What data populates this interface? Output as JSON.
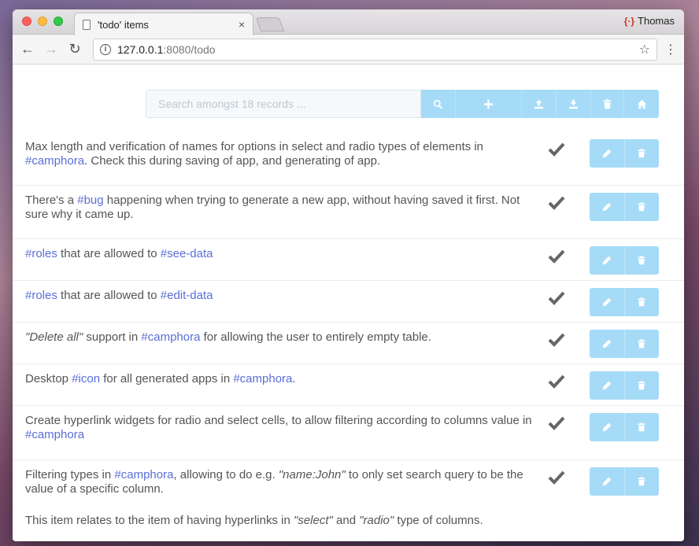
{
  "browser": {
    "tab_title": "'todo' items",
    "tab_close": "×",
    "profile_name": "Thomas",
    "url_host": "127.0.0.1",
    "url_rest": ":8080/todo",
    "back": "←",
    "forward": "→",
    "reload": "↻",
    "star": "☆",
    "menu": "⋮"
  },
  "search": {
    "placeholder": "Search amongst 18 records ...",
    "buttons": [
      "search-icon",
      "plus-icon",
      "upload-icon",
      "download-icon",
      "trash-icon",
      "home-icon"
    ]
  },
  "accent": "#a6dbf7",
  "tag_color": "#5a6fd6",
  "items": [
    {
      "parts": [
        {
          "t": "Max length and verification of names for options in select and radio types of elements in "
        },
        {
          "t": "#camphora",
          "tag": true
        },
        {
          "t": ". Check this during saving of app, and generating of app."
        }
      ],
      "done": true
    },
    {
      "parts": [
        {
          "t": "There's a "
        },
        {
          "t": "#bug",
          "tag": true
        },
        {
          "t": " happening when trying to generate a new app, without having saved it first. Not sure why it came up."
        }
      ],
      "done": true
    },
    {
      "parts": [
        {
          "t": "#roles",
          "tag": true
        },
        {
          "t": " that are allowed to "
        },
        {
          "t": "#see-data",
          "tag": true
        }
      ],
      "done": true
    },
    {
      "parts": [
        {
          "t": "#roles",
          "tag": true
        },
        {
          "t": " that are allowed to "
        },
        {
          "t": "#edit-data",
          "tag": true
        }
      ],
      "done": true
    },
    {
      "parts": [
        {
          "t": "\"Delete all\"",
          "em": true
        },
        {
          "t": " support in "
        },
        {
          "t": "#camphora",
          "tag": true
        },
        {
          "t": " for allowing the user to entirely empty table."
        }
      ],
      "done": true
    },
    {
      "parts": [
        {
          "t": "Desktop "
        },
        {
          "t": "#icon",
          "tag": true
        },
        {
          "t": " for all generated apps in "
        },
        {
          "t": "#camphora",
          "tag": true
        },
        {
          "t": "."
        }
      ],
      "done": true
    },
    {
      "parts": [
        {
          "t": "Create hyperlink widgets for radio and select cells, to allow filtering according to columns value in "
        },
        {
          "t": "#camphora",
          "tag": true
        }
      ],
      "done": true
    },
    {
      "parts": [
        {
          "t": "Filtering types in "
        },
        {
          "t": "#camphora",
          "tag": true
        },
        {
          "t": ", allowing to do e.g. "
        },
        {
          "t": "\"name:John\"",
          "em": true
        },
        {
          "t": " to only set search query to be the value of a specific column."
        }
      ],
      "note_parts": [
        {
          "t": "This item relates to the item of having hyperlinks in "
        },
        {
          "t": "\"select\"",
          "em": true
        },
        {
          "t": " and "
        },
        {
          "t": "\"radio\"",
          "em": true
        },
        {
          "t": " type of columns."
        }
      ],
      "done": true
    }
  ]
}
